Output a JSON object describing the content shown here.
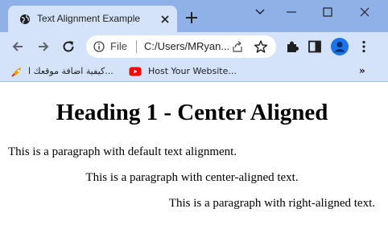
{
  "browser": {
    "tab": {
      "title": "Text Alignment Example"
    },
    "address_bar": {
      "chip_label": "File",
      "url": "C:/Users/MRyan..."
    },
    "bookmarks": [
      {
        "label": "كيفية اضافة موقعك ا...",
        "icon": "rocket-icon"
      },
      {
        "label": "Host Your Website...",
        "icon": "youtube-icon"
      }
    ],
    "bookmarks_more": "»"
  },
  "page": {
    "heading": "Heading 1 - Center Aligned",
    "paragraphs": {
      "default": "This is a paragraph with default text alignment.",
      "center": "This is a paragraph with center-aligned text.",
      "right": "This is a paragraph with right-aligned text."
    }
  },
  "colors": {
    "titlebar": "#8fb1e8",
    "toolbar": "#d4e3fa",
    "accent": "#1a73e8",
    "youtube": "#ff0000"
  }
}
